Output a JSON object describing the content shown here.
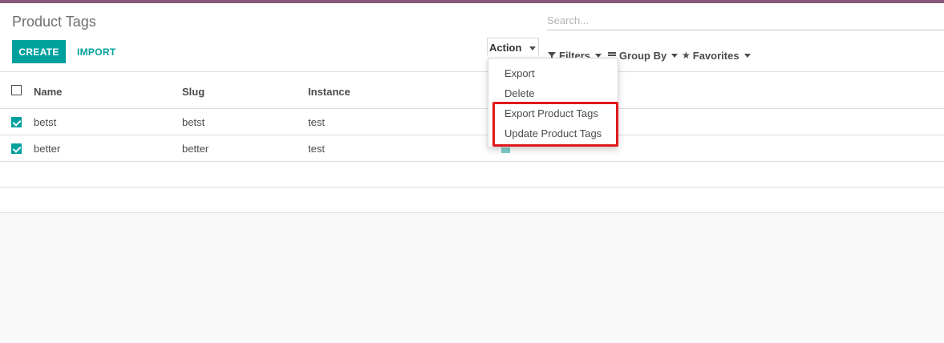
{
  "page": {
    "title": "Product Tags"
  },
  "buttons": {
    "create": "CREATE",
    "import": "IMPORT"
  },
  "search": {
    "placeholder": "Search..."
  },
  "toolbar": {
    "action": "Action",
    "filters": "Filters",
    "group_by": "Group By",
    "favorites": "Favorites"
  },
  "action_menu": {
    "items": [
      "Export",
      "Delete",
      "Export Product Tags",
      "Update Product Tags"
    ]
  },
  "table": {
    "columns": [
      "Name",
      "Slug",
      "Instance"
    ],
    "rows": [
      {
        "name": "betst",
        "slug": "betst",
        "instance": "test",
        "selected": true
      },
      {
        "name": "better",
        "slug": "better",
        "instance": "test",
        "selected": true
      }
    ]
  },
  "colors": {
    "brand": "#875a7b",
    "primary": "#00a09d",
    "highlight": "#e0191b"
  }
}
